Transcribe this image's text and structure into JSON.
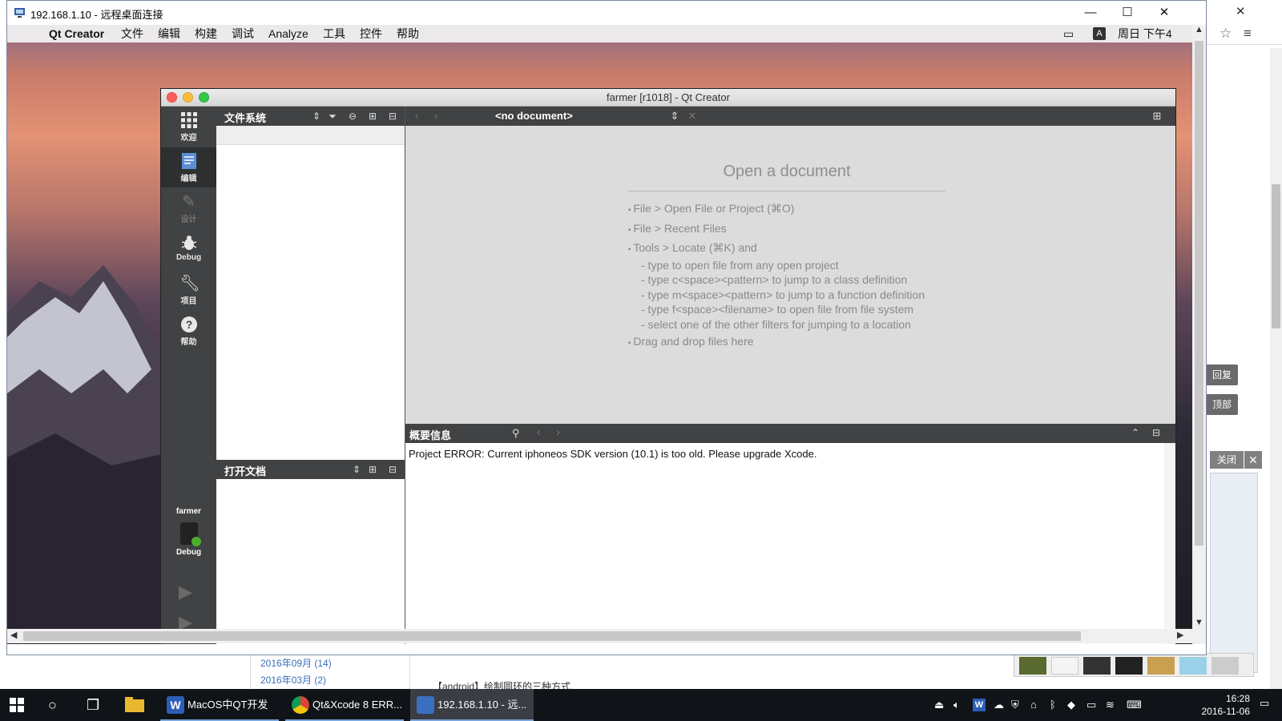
{
  "rdp": {
    "title": "192.168.1.10 - 远程桌面连接"
  },
  "mac_menubar": {
    "app": "Qt Creator",
    "items": [
      "文件",
      "编辑",
      "构建",
      "调试",
      "Analyze",
      "工具",
      "控件",
      "帮助"
    ],
    "input_badge": "A",
    "datetime": "周日 下午4"
  },
  "qtc": {
    "title": "farmer [r1018] - Qt Creator",
    "modes": [
      {
        "label": "欢迎",
        "icon": "grid-icon"
      },
      {
        "label": "编辑",
        "icon": "document-icon"
      },
      {
        "label": "设计",
        "icon": "pencil-icon"
      },
      {
        "label": "Debug",
        "icon": "bug-icon"
      },
      {
        "label": "项目",
        "icon": "wrench-icon"
      },
      {
        "label": "帮助",
        "icon": "help-icon"
      }
    ],
    "kit": {
      "project": "farmer",
      "build": "Debug"
    },
    "left_pane": {
      "filesystem_title": "文件系统",
      "open_docs_title": "打开文档"
    },
    "editor": {
      "document_label": "<no document>"
    },
    "welcome": {
      "title": "Open a document",
      "lines": [
        {
          "type": "bullet",
          "text": "File > Open File or Project (⌘O)"
        },
        {
          "type": "bullet",
          "text": "File > Recent Files"
        },
        {
          "type": "bullet",
          "text": "Tools > Locate (⌘K) and"
        },
        {
          "type": "sub",
          "text": "- type to open file from any open project"
        },
        {
          "type": "sub",
          "text": "- type c<space><pattern> to jump to a class definition"
        },
        {
          "type": "sub",
          "text": "- type m<space><pattern> to jump to a function definition"
        },
        {
          "type": "sub",
          "text": "- type f<space><filename> to open file from file system"
        },
        {
          "type": "sub",
          "text": "- select one of the other filters for jumping to a location"
        },
        {
          "type": "bullet",
          "text": "Drag and drop files here"
        }
      ]
    },
    "output": {
      "title": "概要信息",
      "message": "Project ERROR: Current iphoneos SDK version (10.1) is too old. Please upgrade Xcode."
    }
  },
  "background_browser": {
    "side_buttons": [
      "回复",
      "顶部"
    ],
    "close_label": "关闭",
    "archive": [
      "2016年09月 (14)",
      "2016年03月 (2)"
    ],
    "next_article": "【android】绘制圆环的三种方式"
  },
  "taskbar": {
    "apps": [
      {
        "label": "MacOS中QT开发i...",
        "color": "#2b5eb8"
      },
      {
        "label": "Qt&Xcode 8 ERR...",
        "color": "#e0a020"
      },
      {
        "label": "192.168.1.10 - 远...",
        "color": "#3a6fc0"
      }
    ],
    "time": "16:28",
    "date": "2016-11-06"
  },
  "colors": {
    "qt_dark": "#404244",
    "qt_mode_active": "#2d2f31",
    "editor_bg": "#dcdcdc",
    "taskbar": "#101318"
  }
}
